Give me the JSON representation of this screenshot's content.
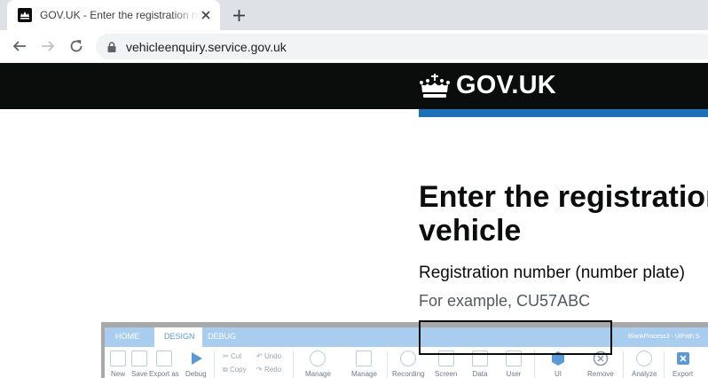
{
  "browser": {
    "tab_title": "GOV.UK - Enter the registration number",
    "url": "vehicleenquiry.service.gov.uk"
  },
  "gov": {
    "logo_text": "GOV.UK",
    "heading_line1": "Enter the registration",
    "heading_line2": "vehicle",
    "field_label": "Registration number (number plate)",
    "field_hint": "For example, CU57ABC",
    "colors": {
      "header_bg": "#0b0c0c",
      "accent_bar": "#1d70b8",
      "focus_border": "#0b0c0c"
    }
  },
  "uipath": {
    "tabs": [
      "HOME",
      "DESIGN",
      "DEBUG"
    ],
    "active_tab": "DESIGN",
    "window_title": "BlankProcess3 - UiPath S",
    "ribbon": {
      "new": "New",
      "save": "Save",
      "export_as": "Export as",
      "debug": "Debug",
      "cut": "Cut",
      "copy": "Copy",
      "undo": "Undo",
      "redo": "Redo",
      "manage1": "Manage",
      "manage2": "Manage",
      "recording": "Recording",
      "screen": "Screen",
      "data": "Data",
      "user": "User",
      "ui": "UI",
      "remove": "Remove",
      "analyze": "Analyze",
      "export": "Export"
    }
  }
}
